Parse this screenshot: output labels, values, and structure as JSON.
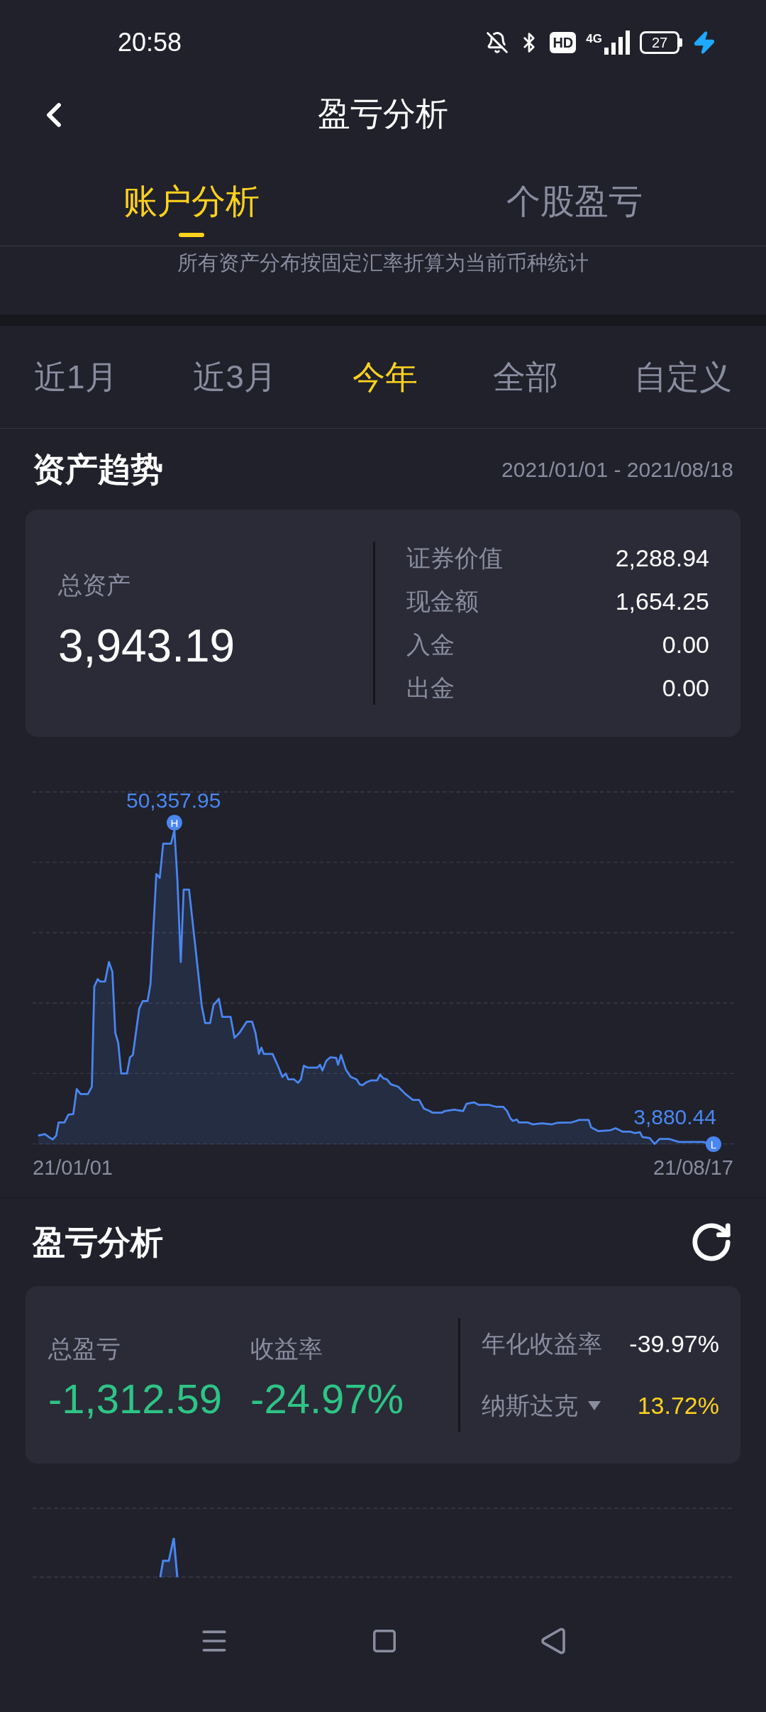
{
  "status_bar": {
    "time": "20:58",
    "hd": "HD",
    "network": "4G",
    "battery": "27"
  },
  "header": {
    "title": "盈亏分析"
  },
  "tabs": [
    {
      "label": "账户分析",
      "selected": true
    },
    {
      "label": "个股盈亏",
      "selected": false
    }
  ],
  "note": "所有资产分布按固定汇率折算为当前币种统计",
  "periods": [
    {
      "label": "近1月",
      "selected": false
    },
    {
      "label": "近3月",
      "selected": false
    },
    {
      "label": "今年",
      "selected": true
    },
    {
      "label": "全部",
      "selected": false
    },
    {
      "label": "自定义",
      "selected": false
    }
  ],
  "asset_trend": {
    "title": "资产趋势",
    "date_range": "2021/01/01 - 2021/08/18",
    "total": {
      "label": "总资产",
      "value": "3,943.19"
    },
    "breakdown": [
      {
        "label": "证券价值",
        "value": "2,288.94"
      },
      {
        "label": "现金额",
        "value": "1,654.25"
      },
      {
        "label": "入金",
        "value": "0.00"
      },
      {
        "label": "出金",
        "value": "0.00"
      }
    ],
    "chart": {
      "high_label": "50,357.95",
      "high_marker": "H",
      "low_label": "3,880.44",
      "low_marker": "L",
      "start_date": "21/01/01",
      "end_date": "21/08/17"
    }
  },
  "pnl": {
    "title": "盈亏分析",
    "metrics": [
      {
        "label": "总盈亏",
        "value": "-1,312.59"
      },
      {
        "label": "收益率",
        "value": "-24.97%"
      }
    ],
    "annualized": {
      "label": "年化收益率",
      "value": "-39.97%"
    },
    "benchmark": {
      "label": "纳斯达克",
      "value": "13.72%"
    }
  }
}
